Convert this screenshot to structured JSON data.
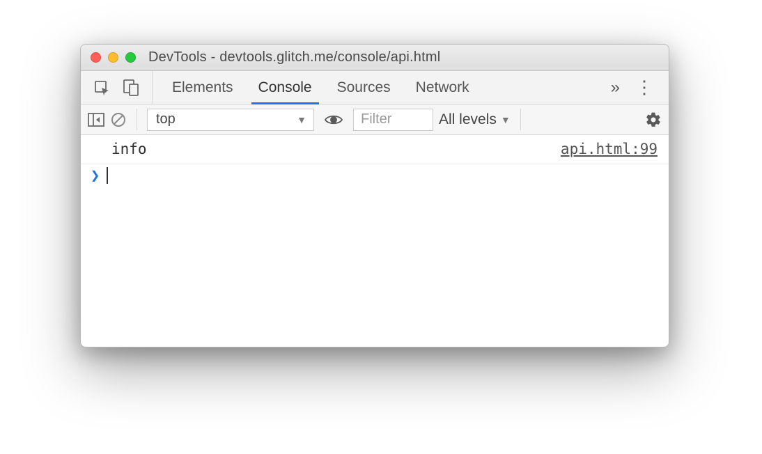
{
  "window": {
    "title": "DevTools - devtools.glitch.me/console/api.html"
  },
  "tabs": {
    "items": [
      "Elements",
      "Console",
      "Sources",
      "Network"
    ],
    "active": "Console",
    "overflow_glyph": "»"
  },
  "filterbar": {
    "context": "top",
    "filter_placeholder": "Filter",
    "levels_label": "All levels"
  },
  "console": {
    "rows": [
      {
        "message": "info",
        "source": "api.html:99"
      }
    ],
    "prompt_glyph": "›"
  }
}
